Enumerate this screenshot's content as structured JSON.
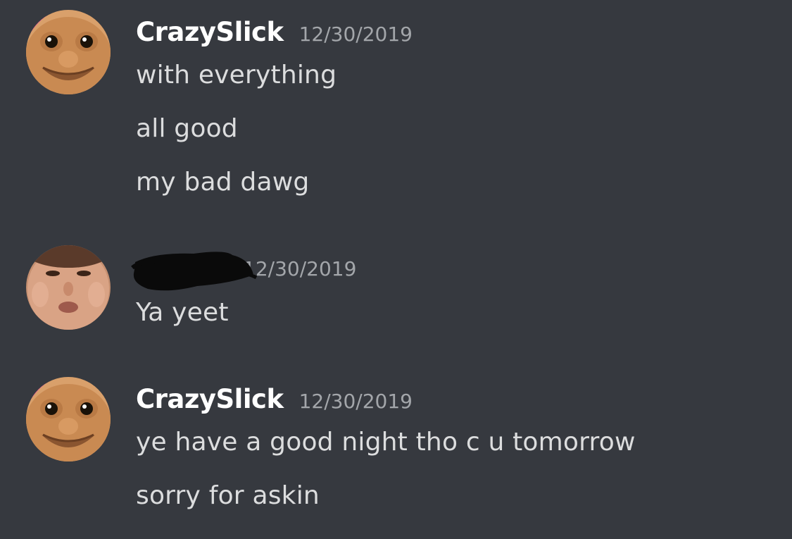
{
  "messages": [
    {
      "username": "CrazySlick",
      "timestamp": "12/30/2019",
      "avatar": "troll-doll-avatar",
      "lines": [
        "with everything",
        "all good",
        "my bad dawg"
      ]
    },
    {
      "username": "",
      "username_redacted": true,
      "timestamp": "12/30/2019",
      "avatar": "face-avatar",
      "lines": [
        "Ya yeet"
      ]
    },
    {
      "username": "CrazySlick",
      "timestamp": "12/30/2019",
      "avatar": "troll-doll-avatar",
      "lines": [
        "ye have a good night tho c u tomorrow",
        "sorry for askin"
      ]
    }
  ],
  "colors": {
    "background": "#36393f",
    "username": "#ffffff",
    "timestamp": "#a3a6aa",
    "message_text": "#dcddde",
    "redaction": "#0a0a0a"
  }
}
